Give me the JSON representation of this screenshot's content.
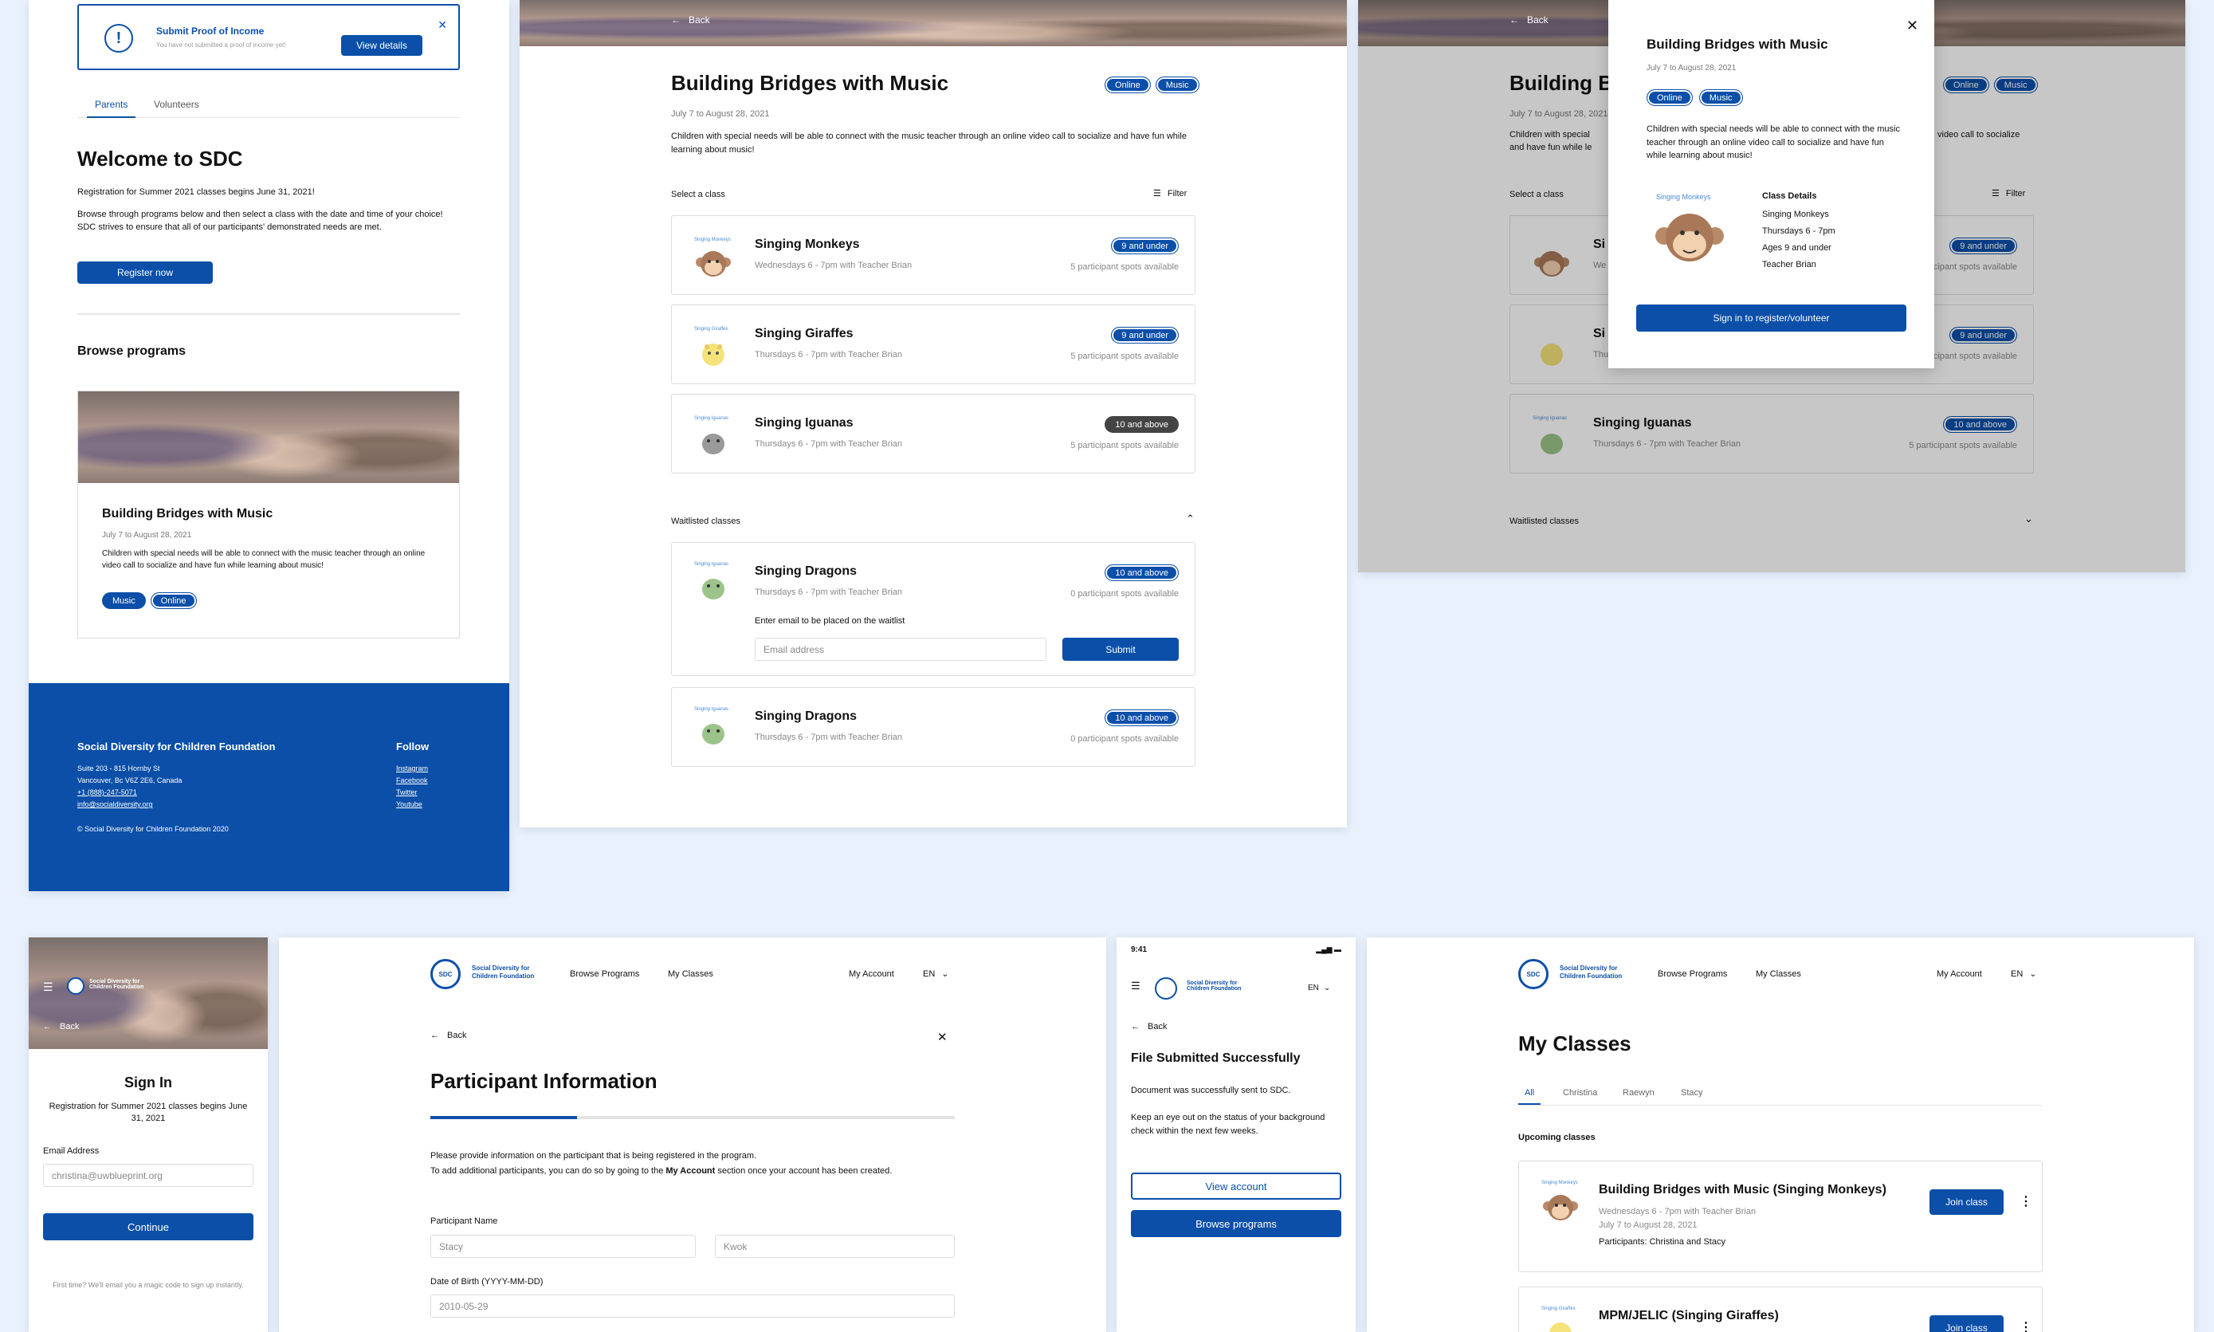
{
  "colors": {
    "brand": "#0b4fa8",
    "bg": "#e9f1fc",
    "dark_pill": "#444444"
  },
  "home": {
    "alert_title": "Submit Proof of Income",
    "alert_sub": "You have not submitted a proof of income yet!",
    "alert_button": "View details",
    "tabs": [
      "Parents",
      "Volunteers"
    ],
    "welcome": "Welcome to SDC",
    "reg_text": "Registration for Summer 2021 classes begins June 31, 2021!",
    "browse_text": "Browse through programs below and then select a class with the date and time of your choice! SDC strives to ensure that all of our participants' demonstrated needs are met.",
    "register_button": "Register now",
    "browse_heading": "Browse programs",
    "program_title": "Building Bridges with Music",
    "program_date": "July 7 to August 28, 2021",
    "program_desc": "Children with special needs will be able to connect with the music teacher through an online video call to socialize and have fun while learning about music!",
    "program_tags": [
      "Music",
      "Online"
    ],
    "footer_org": "Social Diversity for Children Foundation",
    "footer_addr1": "Suite 203 - 815 Hornby St",
    "footer_addr2": "Vancouver, Bc V6Z 2E6, Canada",
    "footer_phone": "+1 (888)-247-5071",
    "footer_email": "info@socialdiversity.org",
    "footer_copy": "© Social Diversity for Children Foundation 2020",
    "follow": "Follow",
    "social": [
      "Instagram",
      "Facebook",
      "Twitter",
      "Youtube"
    ]
  },
  "program": {
    "back": "Back",
    "title": "Building Bridges with Music",
    "tags": [
      "Online",
      "Music"
    ],
    "date": "July 7 to August 28, 2021",
    "desc": "Children with special needs will be able to connect with the music teacher through an online video call to socialize and have fun while learning about music!",
    "select_label": "Select a class",
    "filter": "Filter",
    "classes": [
      {
        "mini": "Singing Monkeys",
        "name": "Singing Monkeys",
        "time": "Wednesdays 6 - 7pm with Teacher Brian",
        "age": "9 and under",
        "spots": "5 participant spots available"
      },
      {
        "mini": "Singing Giraffes",
        "name": "Singing Giraffes",
        "time": "Thursdays 6 - 7pm with Teacher Brian",
        "age": "9 and under",
        "spots": "5 participant spots available"
      },
      {
        "mini": "Singing Iguanas",
        "name": "Singing Iguanas",
        "time": "Thursdays 6 - 7pm with Teacher Brian",
        "age": "10 and above",
        "spots": "5 participant spots available"
      }
    ],
    "waitlist_label": "Waitlisted classes",
    "waitlist": [
      {
        "mini": "Singing Iguanas",
        "name": "Singing Dragons",
        "time": "Thursdays 6 - 7pm with Teacher Brian",
        "age": "10 and above",
        "spots": "0 participant spots available"
      },
      {
        "mini": "Singing Iguanas",
        "name": "Singing Dragons",
        "time": "Thursdays 6 - 7pm with Teacher Brian",
        "age": "10 and above",
        "spots": "0 participant spots available"
      }
    ],
    "waitlist_prompt": "Enter email to be placed on the waitlist",
    "email_placeholder": "Email address",
    "submit": "Submit"
  },
  "modal": {
    "title": "Building Bridges with Music",
    "date": "July 7 to August 28, 2021",
    "tags": [
      "Online",
      "Music"
    ],
    "desc": "Children with special needs will be able to connect with the music teacher through an online video call to socialize and have fun while learning about music!",
    "mini": "Singing Monkeys",
    "details_heading": "Class Details",
    "details": [
      "Singing Monkeys",
      "Thursdays 6 - 7pm",
      "Ages 9 and under",
      "Teacher Brian"
    ],
    "signin_button": "Sign in to register/volunteer",
    "bg_title": "Building B",
    "bg_date": "July 7 to August 28, 2021",
    "bg_desc_l1": "Children with special",
    "bg_desc_l2": "and have fun while le",
    "bg_desc_r": "video call to socialize",
    "bg_names": [
      "Si",
      "Si"
    ],
    "bg_times": [
      "We",
      "Thu"
    ],
    "waitlist_label": "Waitlisted classes"
  },
  "signin": {
    "logo_text": "Social Diversity for Children Foundation",
    "back": "Back",
    "title": "Sign In",
    "reg": "Registration for Summer 2021 classes begins June 31, 2021",
    "email_label": "Email Address",
    "email_value": "christina@uwblueprint.org",
    "continue": "Continue",
    "first_time": "First time? We'll email you a magic code to sign up instantly."
  },
  "participant": {
    "logo_text": "Social Diversity for Children Foundation",
    "nav": [
      "Browse Programs",
      "My Classes"
    ],
    "account": "My Account",
    "lang": "EN",
    "back": "Back",
    "title": "Participant Information",
    "progress": 0.28,
    "intro1": "Please provide information on the participant that is being registered in the program.",
    "intro2a": "To add additional participants, you can do so by going to the ",
    "intro2b": "My Account",
    "intro2c": " section once your account has been created.",
    "name_label": "Participant Name",
    "first": "Stacy",
    "last": "Kwok",
    "dob_label": "Date of Birth (YYYY-MM-DD)",
    "dob": "2010-05-29"
  },
  "mobile": {
    "time": "9:41",
    "logo_text": "Social Diversity for Children Foundation",
    "lang": "EN",
    "back": "Back",
    "title": "File Submitted Successfully",
    "p1": "Document was successfully sent to SDC.",
    "p2": "Keep an eye out on the status of your background check within the next few weeks.",
    "view_account": "View account",
    "browse": "Browse programs"
  },
  "myclasses": {
    "logo_text": "Social Diversity for Children Foundation",
    "nav": [
      "Browse Programs",
      "My Classes"
    ],
    "account": "My Account",
    "lang": "EN",
    "title": "My Classes",
    "tabs": [
      "All",
      "Christina",
      "Raewyn",
      "Stacy"
    ],
    "upcoming": "Upcoming classes",
    "items": [
      {
        "mini": "Singing Monkeys",
        "name": "Building Bridges with Music (Singing Monkeys)",
        "time": "Wednesdays 6 - 7pm with Teacher Brian",
        "date": "July 7 to August 28, 2021",
        "participants": "Participants: Christina and Stacy",
        "button": "Join class"
      },
      {
        "mini": "Singing Giraffes",
        "name": "MPM/JELIC (Singing Giraffes)",
        "button": "Join class"
      }
    ]
  }
}
